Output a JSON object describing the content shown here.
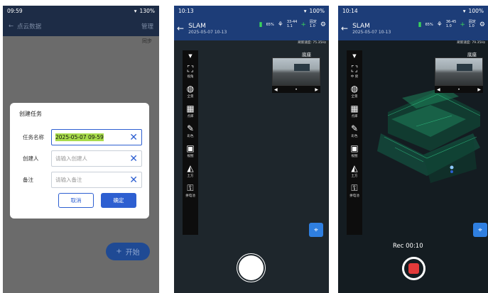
{
  "phone1": {
    "status": {
      "time": "09:59",
      "battery": "130%"
    },
    "appbar": {
      "back_title": "点云数据",
      "action": "管理"
    },
    "subbar": {
      "label": "同步"
    },
    "dialog": {
      "title": "创建任务",
      "fields": [
        {
          "label": "任务名称",
          "value": "2025-05-07 09-59",
          "placeholder": ""
        },
        {
          "label": "创建人",
          "value": "",
          "placeholder": "请输入创建人"
        },
        {
          "label": "备注",
          "value": "",
          "placeholder": "请输入备注"
        }
      ],
      "cancel": "取消",
      "confirm": "确定"
    },
    "start_button": "开始"
  },
  "phone2": {
    "status": {
      "time": "10:13",
      "battery": "100%"
    },
    "title": "SLAM",
    "subtitle": "2025-05-07 10-13",
    "battery_pct": "65%",
    "stat1": [
      "33-44",
      "1.1"
    ],
    "stat2": [
      "固定",
      "1.0"
    ],
    "speed": "刷新速度: 75.35Hz",
    "cam_label": "底座",
    "tools": [
      "视角",
      "全景",
      "点库",
      "彩色",
      "规图",
      "土方",
      "拼电池"
    ]
  },
  "phone3": {
    "status": {
      "time": "10:14",
      "battery": "100%"
    },
    "title": "SLAM",
    "subtitle": "2025-05-07 10-13",
    "battery_pct": "65%",
    "stat1": [
      "36-45",
      "1.0"
    ],
    "stat2": [
      "固定",
      "1.0"
    ],
    "speed": "刷新速度: 79.35Hz",
    "cam_label": "底座",
    "tools": [
      "中 俯",
      "全景",
      "点库",
      "彩色",
      "规图",
      "土方",
      "拼电池"
    ],
    "rec": "Rec 00:10"
  },
  "icons": {
    "back": "back-arrow-icon",
    "clear": "close-icon",
    "add": "plus-icon",
    "location": "location-pin-icon"
  },
  "colors": {
    "accent": "#2d5fd1",
    "topbar": "#1d3d78",
    "record": "#e33a3a"
  }
}
